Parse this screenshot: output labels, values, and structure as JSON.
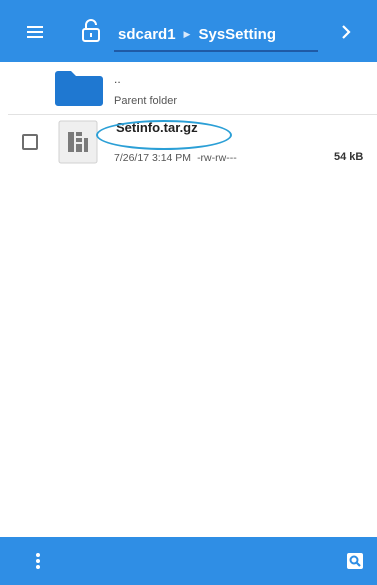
{
  "header": {
    "breadcrumb": [
      "sdcard1",
      "SysSetting"
    ],
    "menu_icon": "hamburger-menu-icon",
    "lock_icon": "unlocked-padlock-icon",
    "forward_icon": "chevron-right-icon",
    "accent_color": "#2f8ee5"
  },
  "parent_row": {
    "dots": "..",
    "label": "Parent folder",
    "icon": "folder-icon",
    "icon_color": "#1f78d1"
  },
  "files": [
    {
      "name": "Setinfo.tar.gz",
      "date": "7/26/17 3:14 PM",
      "permissions": "-rw-rw---",
      "size": "54 kB",
      "icon": "archive-file-icon",
      "checked": false,
      "annotation_color": "#2b9fd6"
    }
  ],
  "footer": {
    "more_icon": "more-vertical-icon",
    "search_icon": "search-icon"
  }
}
